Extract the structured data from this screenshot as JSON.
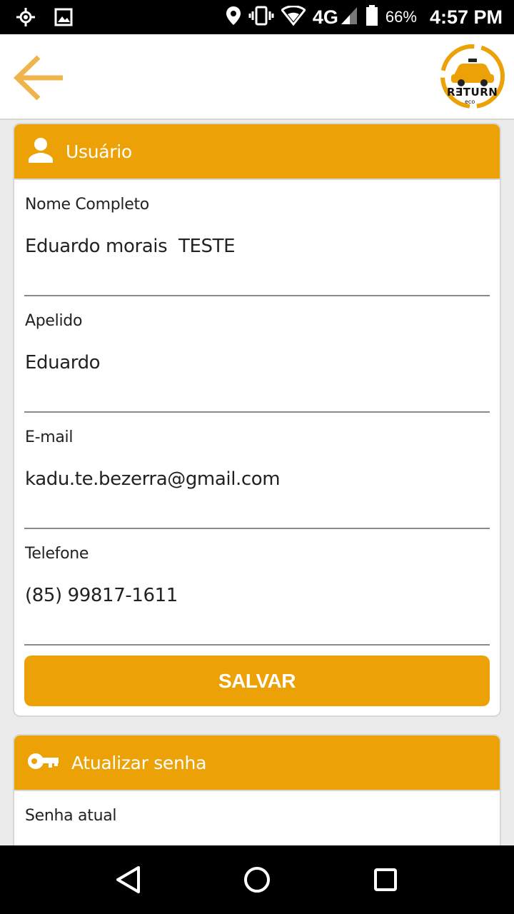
{
  "status_bar": {
    "network": "4G",
    "battery_percent": "66%",
    "time": "4:57 PM",
    "icons": [
      "location-target-icon",
      "image-icon",
      "location-pin-icon",
      "vibrate-icon",
      "wifi-icon",
      "signal-icon",
      "battery-icon"
    ]
  },
  "app_bar": {
    "back_icon": "arrow-left-icon",
    "logo_text": "R∃TURN",
    "logo_subtext": "eco"
  },
  "user_card": {
    "title": "Usuário",
    "icon": "person-icon",
    "fields": [
      {
        "label": "Nome Completo",
        "value": "Eduardo morais  TESTE"
      },
      {
        "label": "Apelido",
        "value": "Eduardo"
      },
      {
        "label": "E-mail",
        "value": "kadu.te.bezerra@gmail.com"
      },
      {
        "label": "Telefone",
        "value": "(85) 99817-1611"
      }
    ],
    "save_label": "SALVAR"
  },
  "password_card": {
    "title": "Atualizar senha",
    "icon": "key-icon",
    "current_password_label": "Senha atual"
  },
  "nav_bar": {
    "icons": [
      "back-triangle-icon",
      "home-circle-icon",
      "recents-square-icon"
    ]
  },
  "colors": {
    "accent": "#eca206",
    "back_arrow": "#f0b44c",
    "background": "#ebebeb"
  }
}
